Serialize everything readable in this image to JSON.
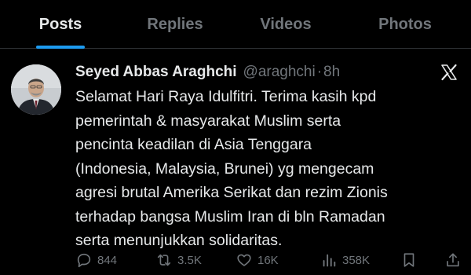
{
  "tabs": [
    {
      "label": "Posts",
      "active": true
    },
    {
      "label": "Replies",
      "active": false
    },
    {
      "label": "Videos",
      "active": false
    },
    {
      "label": "Photos",
      "active": false
    }
  ],
  "tweet": {
    "author": {
      "display_name": "Seyed Abbas Araghchi",
      "handle": "@araghchi",
      "separator": "·",
      "time": "8h"
    },
    "text": "Selamat Hari Raya Idulfitri. Terima kasih kpd\npemerintah & masyarakat Muslim serta\npencinta keadilan di Asia Tenggara\n(Indonesia, Malaysia, Brunei) yg mengecam\nagresi brutal Amerika Serikat dan rezim Zionis\nterhadap bangsa Muslim Iran di bln Ramadan\nserta menunjukkan solidaritas."
  },
  "actions": {
    "replies": "844",
    "reposts": "3.5K",
    "likes": "16K",
    "views": "358K"
  },
  "colors": {
    "background": "#000000",
    "text": "#e7e9ea",
    "muted": "#71767b",
    "accent": "#1d9bf0",
    "divider": "#2f3336"
  }
}
